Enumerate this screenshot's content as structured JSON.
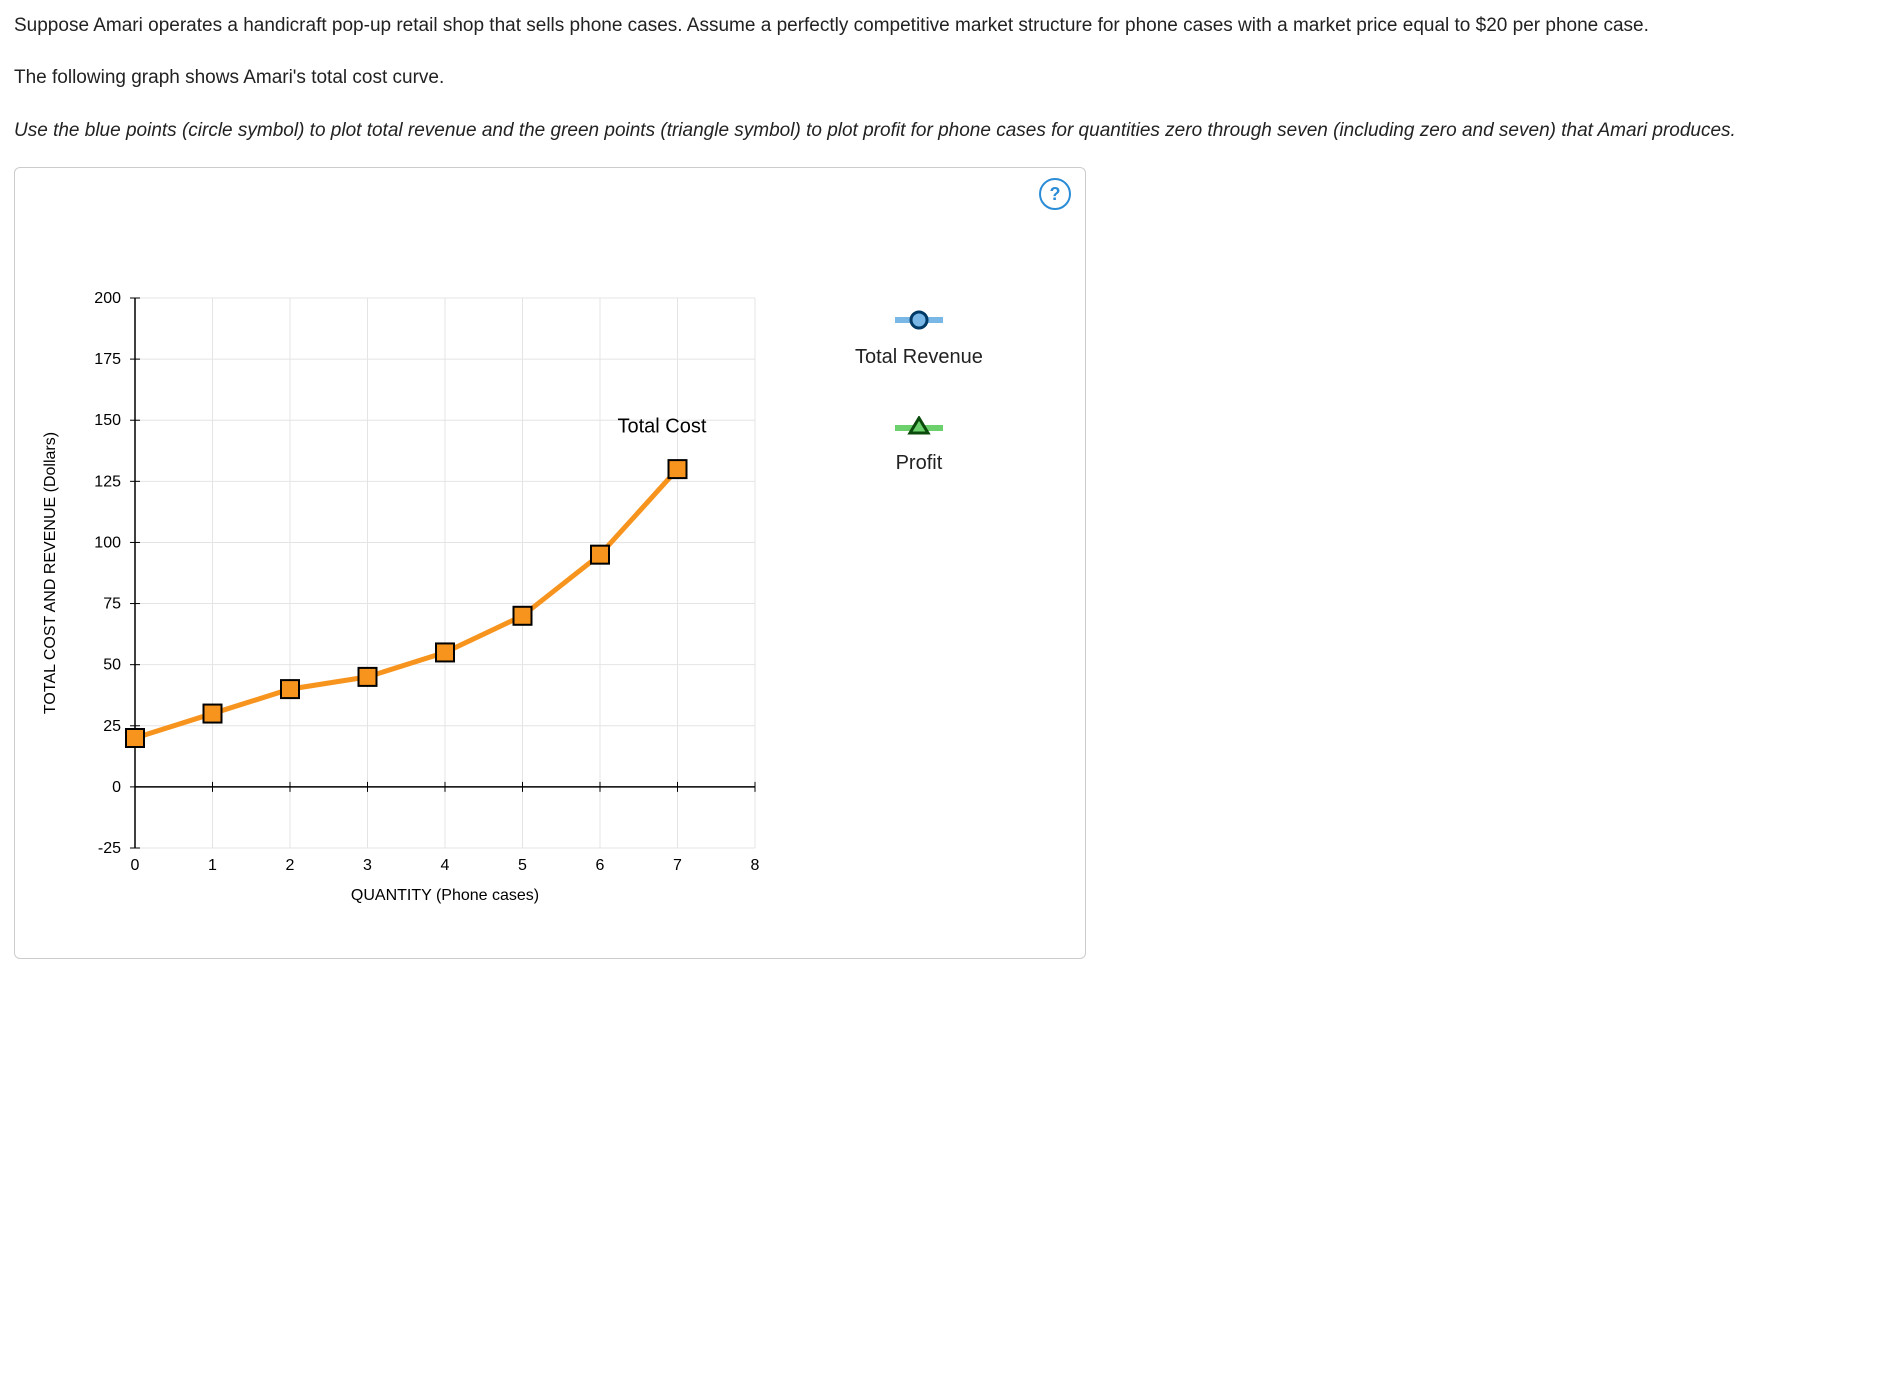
{
  "text": {
    "p1": "Suppose Amari operates a handicraft pop-up retail shop that sells phone cases. Assume a perfectly competitive market structure for phone cases with a market price equal to $20 per phone case.",
    "p2": "The following graph shows Amari's total cost curve.",
    "p3": "Use the blue points (circle symbol) to plot total revenue and the green points (triangle symbol) to plot profit for phone cases for quantities zero through seven (including zero and seven) that Amari produces."
  },
  "help": "?",
  "legend": {
    "tr": "Total Revenue",
    "profit": "Profit"
  },
  "chart_data": {
    "type": "line",
    "xlabel": "QUANTITY (Phone cases)",
    "ylabel": "TOTAL COST AND REVENUE (Dollars)",
    "x_ticks": [
      0,
      1,
      2,
      3,
      4,
      5,
      6,
      7,
      8
    ],
    "y_ticks": [
      -25,
      0,
      25,
      50,
      75,
      100,
      125,
      150,
      175,
      200
    ],
    "xlim": [
      0,
      8
    ],
    "ylim": [
      -25,
      200
    ],
    "series": [
      {
        "name": "Total Cost",
        "x": [
          0,
          1,
          2,
          3,
          4,
          5,
          6,
          7
        ],
        "y": [
          20,
          30,
          40,
          45,
          55,
          70,
          95,
          130
        ],
        "color": "#f7941e",
        "marker": "square"
      }
    ],
    "annotations": [
      {
        "text": "Total Cost",
        "x": 7,
        "y": 145,
        "anchor": "start"
      }
    ]
  }
}
